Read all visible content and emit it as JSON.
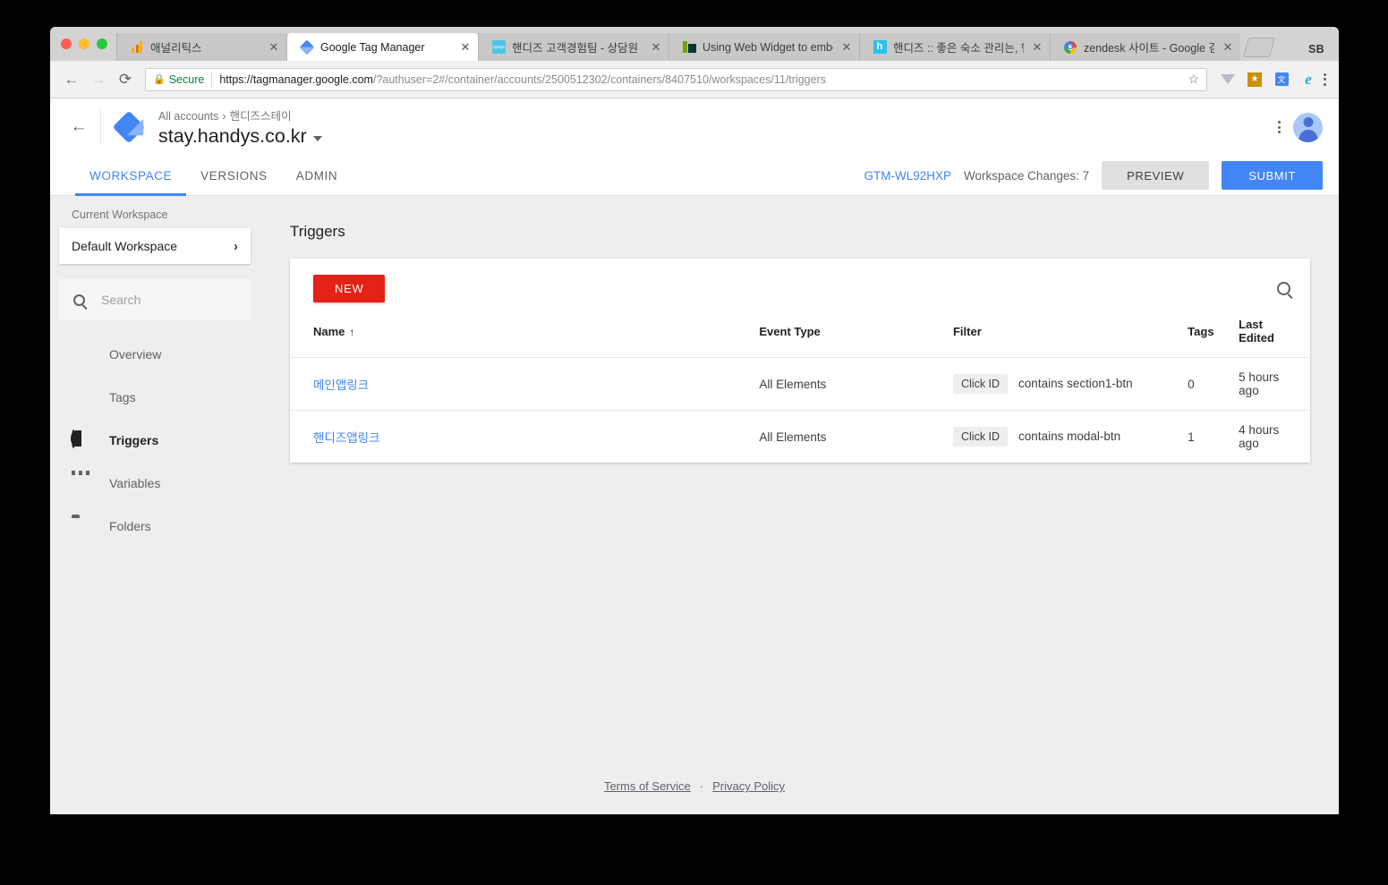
{
  "browser": {
    "tabs": [
      {
        "title": "애널리틱스",
        "favicon": "analytics-icon",
        "active": false
      },
      {
        "title": "Google Tag Manager",
        "favicon": "tag-manager-icon",
        "active": true
      },
      {
        "title": "핸디즈 고객경험팀 - 상담원",
        "favicon": "handys-icon",
        "active": false
      },
      {
        "title": "Using Web Widget to embed",
        "favicon": "zendesk-icon",
        "active": false
      },
      {
        "title": "핸디즈 :: 좋은 숙소 관리는, 핸디즈",
        "favicon": "handys-h-icon",
        "active": false
      },
      {
        "title": "zendesk 사이트 - Google 검색",
        "favicon": "google-icon",
        "active": false
      }
    ],
    "close_label": "✕",
    "profile_name": "SB",
    "nav": {
      "back": "←",
      "forward": "→",
      "reload": "⟳"
    },
    "omnibox": {
      "secure_label": "Secure",
      "url_host": "https://tagmanager.google.com",
      "url_path": "/?authuser=2#/container/accounts/2500512302/containers/8407510/workspaces/11/triggers",
      "star": "☆"
    },
    "extensions": [
      "v-icon",
      "star-extension-icon",
      "google-translate-icon",
      "internet-explorer-icon",
      "chrome-menu-icon"
    ],
    "ext_star_glyph": "★",
    "ext_translate_glyph": "文",
    "ext_ie_glyph": "e"
  },
  "header": {
    "back_arrow": "←",
    "breadcrumb_root": "All accounts",
    "breadcrumb_sep": "›",
    "breadcrumb_account": "핸디즈스테이",
    "container_title": "stay.handys.co.kr",
    "overflow_menu": "more-vert-icon"
  },
  "nav_tabs": {
    "items": [
      {
        "label": "WORKSPACE",
        "active": true
      },
      {
        "label": "VERSIONS",
        "active": false
      },
      {
        "label": "ADMIN",
        "active": false
      }
    ],
    "container_id": "GTM-WL92HXP",
    "workspace_changes": "Workspace Changes: 7",
    "preview_label": "PREVIEW",
    "submit_label": "SUBMIT"
  },
  "sidebar": {
    "current_workspace_label": "Current Workspace",
    "workspace_name": "Default Workspace",
    "workspace_arrow": "›",
    "search_placeholder": "Search",
    "search_value": "",
    "items": [
      {
        "label": "Overview",
        "icon": "overview-icon",
        "active": false
      },
      {
        "label": "Tags",
        "icon": "tag-icon",
        "active": false
      },
      {
        "label": "Triggers",
        "icon": "trigger-icon",
        "active": true
      },
      {
        "label": "Variables",
        "icon": "variables-icon",
        "active": false
      },
      {
        "label": "Folders",
        "icon": "folder-icon",
        "active": false
      }
    ]
  },
  "main": {
    "title": "Triggers",
    "new_button": "NEW",
    "search_icon": "search-icon",
    "columns": [
      "Name",
      "Event Type",
      "Filter",
      "Tags",
      "Last Edited"
    ],
    "sort_indicator": "↑",
    "rows": [
      {
        "name": "메인앱링크",
        "event_type": "All Elements",
        "filter_chip": "Click ID",
        "filter_text": "contains section1-btn",
        "tags": "0",
        "last_edited": "5 hours ago"
      },
      {
        "name": "핸디즈앱링크",
        "event_type": "All Elements",
        "filter_chip": "Click ID",
        "filter_text": "contains modal-btn",
        "tags": "1",
        "last_edited": "4 hours ago"
      }
    ]
  },
  "footer": {
    "terms": "Terms of Service",
    "separator": "·",
    "privacy": "Privacy Policy"
  },
  "colors": {
    "accent_blue": "#4285f4",
    "new_red": "#e62117",
    "secure_green": "#0b8043",
    "page_bg": "#eeeeee"
  }
}
